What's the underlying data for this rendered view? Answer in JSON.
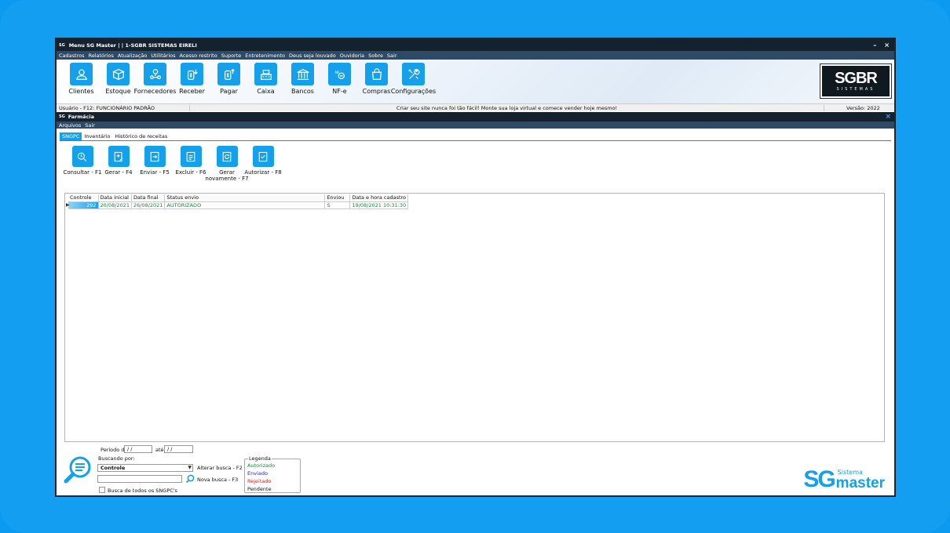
{
  "window": {
    "badge": "SG",
    "title": "Menu SG Master | | 1-SGBR SISTEMAS EIRELI",
    "minimize": "–",
    "close": "×"
  },
  "menu": [
    "Cadastros",
    "Relatórios",
    "Atualização",
    "Utilitários",
    "Acesso restrito",
    "Suporte",
    "Entretenimento",
    "Deus seja louvado",
    "Ouvidoria",
    "Sobre",
    "Sair"
  ],
  "ribbon": [
    {
      "label": "Clientes",
      "icon": "user-icon"
    },
    {
      "label": "Estoque",
      "icon": "box-icon"
    },
    {
      "label": "Fornecedores",
      "icon": "supplier-icon"
    },
    {
      "label": "Receber",
      "icon": "money-in-icon"
    },
    {
      "label": "Pagar",
      "icon": "money-out-icon"
    },
    {
      "label": "Caixa",
      "icon": "cash-register-icon"
    },
    {
      "label": "Bancos",
      "icon": "bank-icon"
    },
    {
      "label": "NF-e",
      "icon": "nfe-icon"
    },
    {
      "label": "Compras",
      "icon": "shopping-bag-icon"
    },
    {
      "label": "Configurações",
      "icon": "tools-icon"
    }
  ],
  "logo": {
    "big": "SGBR",
    "small": "SISTEMAS"
  },
  "status": {
    "user": "Usuário - F12: FUNCIONÁRIO PADRÃO",
    "message": "Criar seu site nunca foi tão fácil! Monte sua loja virtual e comece vender hoje mesmo!",
    "version": "Versão: 2022"
  },
  "subwindow": {
    "badge": "SG",
    "title": "Farmácia",
    "close": "×"
  },
  "submenu": [
    "Arquivos",
    "Sair"
  ],
  "tabs": [
    "SNGPC",
    "Inventário",
    "Histórico de receitas"
  ],
  "tools": [
    {
      "label": "Consultar - F1",
      "icon": "consult-icon"
    },
    {
      "label": "Gerar - F4",
      "icon": "generate-icon"
    },
    {
      "label": "Enviar - F5",
      "icon": "send-icon"
    },
    {
      "label": "Excluir - F6",
      "icon": "delete-icon"
    },
    {
      "label1": "Gerar",
      "label2": "novamente - F7",
      "icon": "regenerate-icon"
    },
    {
      "label": "Autorizar - F8",
      "icon": "authorize-icon"
    }
  ],
  "grid": {
    "columns": [
      "Controle",
      "Data inicial",
      "Data final",
      "Status envio",
      "Enviou",
      "Data e hora cadastro"
    ],
    "rows": [
      [
        "292",
        "20/08/2021",
        "26/08/2021",
        "AUTORIZADO",
        "S",
        "19/08/2021 10:31:30"
      ]
    ]
  },
  "search": {
    "period_label": "Período de",
    "date_from": " /  /",
    "to_label": "até",
    "date_to": " /  /",
    "by_label": "Buscando por:",
    "combo_value": "Controle",
    "alter": "Alterar busca - F2",
    "new": "Nova busca - F3",
    "all_label": "Busca de todos os SNGPC's"
  },
  "legend": {
    "title": "Legenda",
    "items": [
      {
        "label": "Autorizado",
        "color": "#0a8f3a"
      },
      {
        "label": "Enviado",
        "color": "#1a2bd1"
      },
      {
        "label": "Rejeitado",
        "color": "#e01b1b"
      },
      {
        "label": "Pendente",
        "color": "#111111"
      }
    ]
  },
  "brand": {
    "sg": "SG",
    "sistema": "Sistema",
    "master": "master"
  },
  "colors": {
    "accent": "#14a0ea",
    "title_bg": "#142230",
    "menu_bg": "#2d4a66"
  }
}
